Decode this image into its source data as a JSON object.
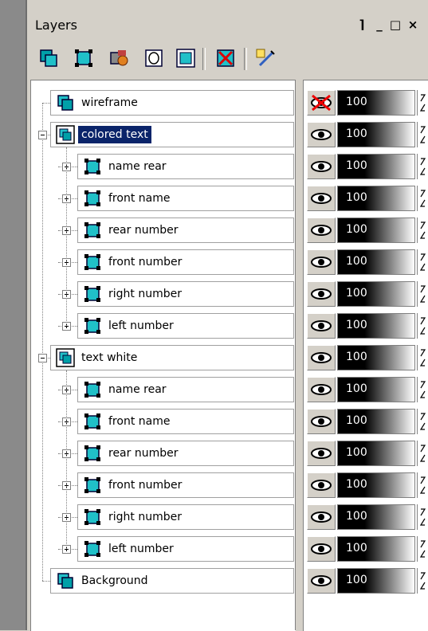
{
  "panel": {
    "title": "Layers",
    "title_buttons": [
      "⌉",
      "_",
      "□",
      "×"
    ]
  },
  "toolbar": {
    "tools": [
      {
        "name": "new-layer-icon"
      },
      {
        "name": "new-group-icon"
      },
      {
        "name": "new-adjustment-icon"
      },
      {
        "name": "new-mask-icon"
      },
      {
        "name": "merge-icon"
      },
      {
        "name": "delete-layer-icon"
      },
      {
        "name": "layer-properties-icon"
      }
    ]
  },
  "layers": [
    {
      "label": "wireframe",
      "depth": 0,
      "type": "layer",
      "visible": false,
      "opacity": "100",
      "expander": "none"
    },
    {
      "label": "colored text",
      "depth": 0,
      "type": "group",
      "visible": true,
      "opacity": "100",
      "expander": "minus",
      "selected": true
    },
    {
      "label": "name rear",
      "depth": 1,
      "type": "group-layer",
      "visible": true,
      "opacity": "100",
      "expander": "plus"
    },
    {
      "label": "front name",
      "depth": 1,
      "type": "group-layer",
      "visible": true,
      "opacity": "100",
      "expander": "plus"
    },
    {
      "label": "rear number",
      "depth": 1,
      "type": "group-layer",
      "visible": true,
      "opacity": "100",
      "expander": "plus"
    },
    {
      "label": "front number",
      "depth": 1,
      "type": "group-layer",
      "visible": true,
      "opacity": "100",
      "expander": "plus"
    },
    {
      "label": "right number",
      "depth": 1,
      "type": "group-layer",
      "visible": true,
      "opacity": "100",
      "expander": "plus"
    },
    {
      "label": "left number",
      "depth": 1,
      "type": "group-layer",
      "visible": true,
      "opacity": "100",
      "expander": "plus"
    },
    {
      "label": "text white",
      "depth": 0,
      "type": "group",
      "visible": true,
      "opacity": "100",
      "expander": "minus"
    },
    {
      "label": "name rear",
      "depth": 1,
      "type": "group-layer",
      "visible": true,
      "opacity": "100",
      "expander": "plus"
    },
    {
      "label": "front name",
      "depth": 1,
      "type": "group-layer",
      "visible": true,
      "opacity": "100",
      "expander": "plus"
    },
    {
      "label": "rear number",
      "depth": 1,
      "type": "group-layer",
      "visible": true,
      "opacity": "100",
      "expander": "plus"
    },
    {
      "label": "front number",
      "depth": 1,
      "type": "group-layer",
      "visible": true,
      "opacity": "100",
      "expander": "plus"
    },
    {
      "label": "right number",
      "depth": 1,
      "type": "group-layer",
      "visible": true,
      "opacity": "100",
      "expander": "plus"
    },
    {
      "label": "left number",
      "depth": 1,
      "type": "group-layer",
      "visible": true,
      "opacity": "100",
      "expander": "plus"
    },
    {
      "label": "Background",
      "depth": 0,
      "type": "layer",
      "visible": true,
      "opacity": "100",
      "expander": "none"
    }
  ],
  "colors": {
    "selection": "#0a246a",
    "icon_teal": "#00a0a8",
    "chrome": "#d4d0c8"
  }
}
